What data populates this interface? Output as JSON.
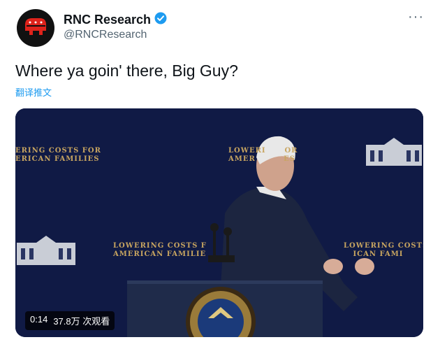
{
  "author": {
    "name": "RNC Research",
    "handle": "@RNCResearch",
    "verified": true,
    "avatar_icon": "elephant-logo-icon",
    "avatar_color": "#e0231b"
  },
  "menu": {
    "more_icon": "more-icon",
    "more_label": "···"
  },
  "tweet": {
    "text": "Where ya goin' there, Big Guy?",
    "translate_label": "翻译推文"
  },
  "media": {
    "type": "video",
    "duration": "0:14",
    "views": "37.8万 次观看",
    "banners": [
      "ERING COSTS FOR\nERICAN FAMILIES",
      "LOWERI      OR\nAMER         ES",
      "LOWERING COSTS F\nAMERICAN FAMILIE",
      "LOWERING COSTS\n   ICAN FAMI"
    ]
  },
  "colors": {
    "text": "#0f1419",
    "secondary": "#536471",
    "link": "#1d9bf0",
    "verified": "#1d9bf0"
  }
}
